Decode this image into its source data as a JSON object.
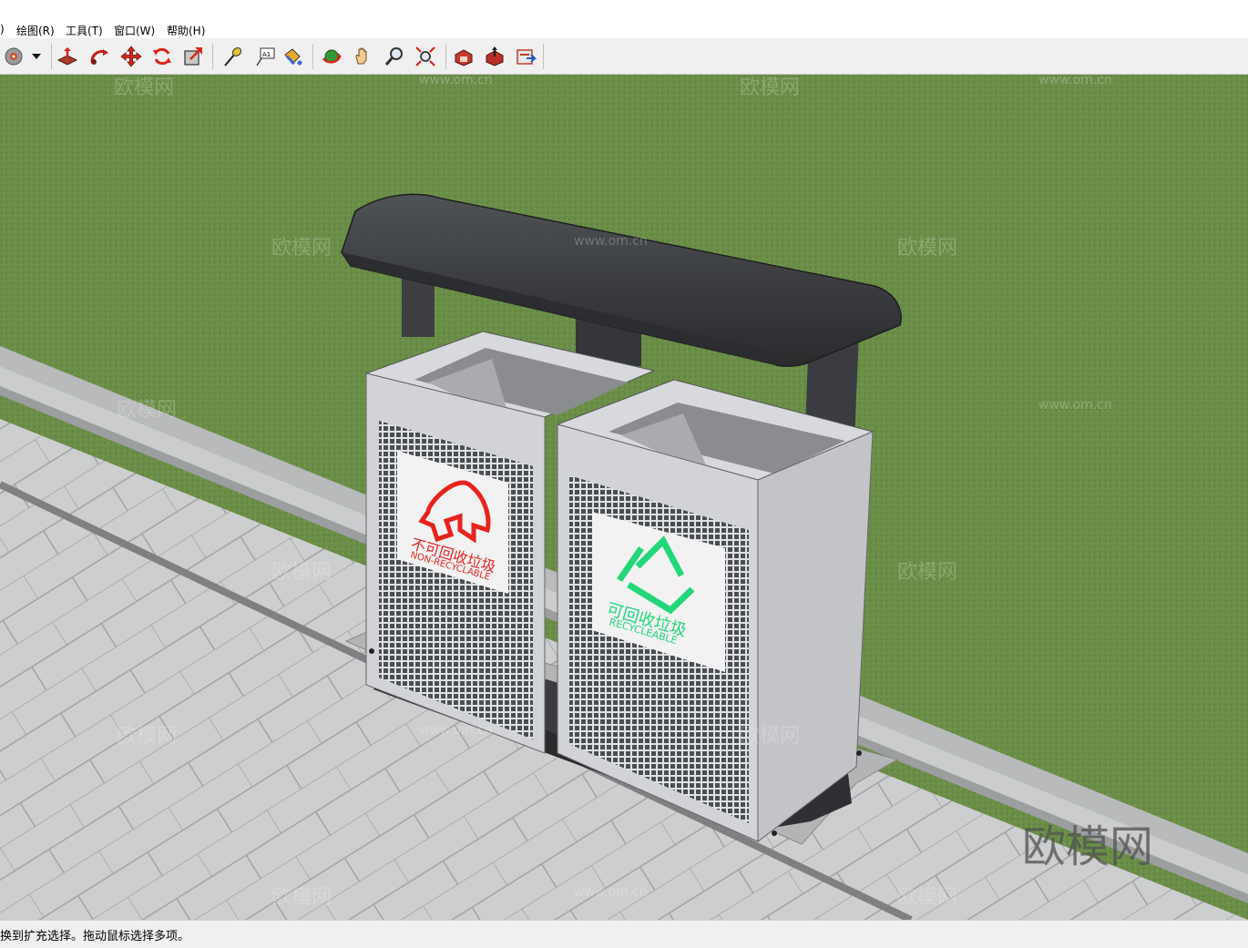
{
  "menubar": {
    "items": [
      {
        "label": ")"
      },
      {
        "label": "绘图(R)"
      },
      {
        "label": "工具(T)"
      },
      {
        "label": "窗口(W)"
      },
      {
        "label": "帮助(H)"
      }
    ]
  },
  "toolbar": {
    "tools": [
      {
        "icon": "eraser-disc-icon"
      },
      {
        "icon": "dropdown-arrow-icon"
      },
      {
        "icon": "push-pull-icon"
      },
      {
        "icon": "follow-me-icon"
      },
      {
        "icon": "move-icon"
      },
      {
        "icon": "rotate-icon"
      },
      {
        "icon": "scale-icon"
      },
      {
        "icon": "tape-measure-icon"
      },
      {
        "icon": "text-icon"
      },
      {
        "icon": "paint-bucket-icon"
      },
      {
        "icon": "orbit-icon"
      },
      {
        "icon": "pan-hand-icon"
      },
      {
        "icon": "zoom-icon"
      },
      {
        "icon": "zoom-extents-icon"
      },
      {
        "icon": "warehouse-icon"
      },
      {
        "icon": "share-model-icon"
      },
      {
        "icon": "extension-warehouse-icon"
      }
    ]
  },
  "scene": {
    "left_bin": {
      "label_cn": "不可回收垃圾",
      "label_en": "NON-RECYCLABLE",
      "color": "#e8231e"
    },
    "right_bin": {
      "label_cn": "可回收垃圾",
      "label_en": "RECYCLEABLE",
      "color": "#22d67a"
    },
    "colors": {
      "grass": "#6a8e48",
      "pavement": "#c9cacb",
      "frame": "#3c3e40",
      "bin": "#d4d6d9"
    },
    "watermark": {
      "logo": "欧模网",
      "url": "www.om.cn"
    }
  },
  "statusbar": {
    "text": "换到扩充选择。拖动鼠标选择多项。"
  }
}
